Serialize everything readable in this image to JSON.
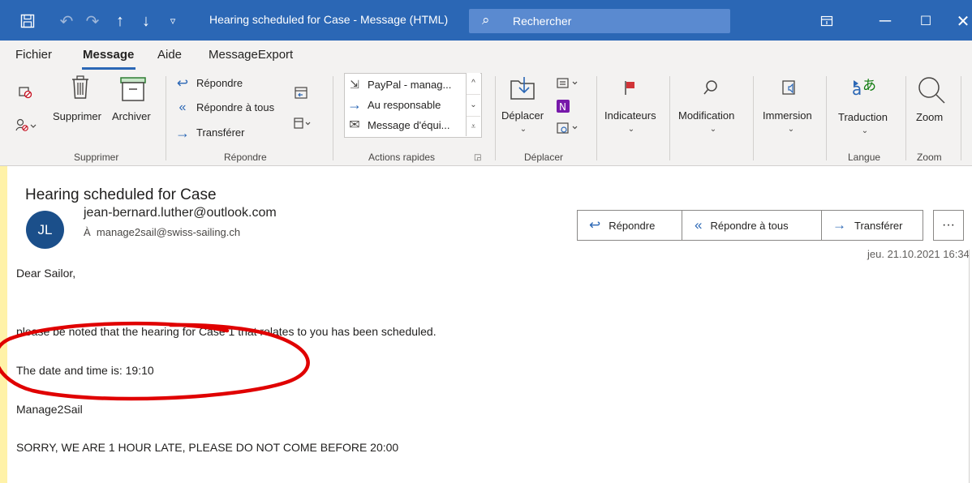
{
  "titlebar": {
    "title": "Hearing scheduled for Case  -  Message (HTML)",
    "search_placeholder": "Rechercher",
    "accent_color": "#2b67b5"
  },
  "menu": {
    "tabs": [
      "Fichier",
      "Message",
      "Aide",
      "MessageExport"
    ],
    "active": "Message"
  },
  "ribbon": {
    "delete_group": {
      "delete": "Supprimer",
      "archive": "Archiver",
      "label": "Supprimer"
    },
    "reply_group": {
      "reply": "Répondre",
      "reply_all": "Répondre à tous",
      "forward": "Transférer",
      "label": "Répondre"
    },
    "quick_steps": {
      "items": [
        "PayPal - manag...",
        "Au responsable",
        "Message d'équi..."
      ],
      "label": "Actions rapides"
    },
    "move_group": {
      "move": "Déplacer",
      "label": "Déplacer"
    },
    "tags": {
      "flags": "Indicateurs"
    },
    "editing": {
      "modify": "Modification"
    },
    "immersive": {
      "immersion": "Immersion"
    },
    "language": {
      "translate": "Traduction",
      "label": "Langue"
    },
    "zoom": {
      "zoom": "Zoom",
      "label": "Zoom"
    }
  },
  "message": {
    "subject": "Hearing scheduled for Case",
    "avatar_initials": "JL",
    "avatar_color": "#1b4f8a",
    "from": "jean-bernard.luther@outlook.com",
    "to_prefix": "À",
    "to": "manage2sail@swiss-sailing.ch",
    "date": "jeu. 21.10.2021 16:34",
    "actions": {
      "reply": "Répondre",
      "reply_all": "Répondre à tous",
      "forward": "Transférer",
      "more": "···"
    },
    "body": [
      "Dear Sailor,",
      "please be noted that the hearing for Case 1 that relates to you has been scheduled.",
      "The date and time is:  19:10",
      "Manage2Sail",
      "SORRY, WE ARE 1 HOUR LATE, PLEASE DO NOT COME BEFORE 20:00"
    ],
    "annotation_color": "#e00000"
  }
}
